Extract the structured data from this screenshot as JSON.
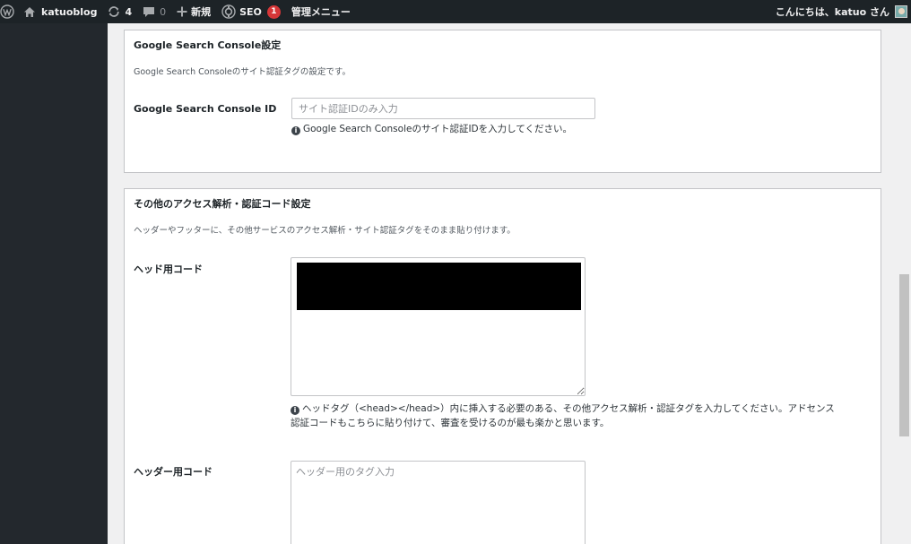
{
  "adminbar": {
    "site_name": "katuoblog",
    "updates_count": "4",
    "comments_count": "0",
    "new_label": "新規",
    "seo_label": "SEO",
    "seo_badge": "1",
    "admin_menu_label": "管理メニュー",
    "greeting": "こんにちは、katuo さん"
  },
  "gsc_panel": {
    "title": "Google Search Console設定",
    "description": "Google Search Consoleのサイト認証タグの設定です。",
    "field_label": "Google Search Console ID",
    "field_placeholder": "サイト認証IDのみ入力",
    "field_value": "",
    "help_text": "Google Search Consoleのサイト認証IDを入力してください。"
  },
  "other_panel": {
    "title": "その他のアクセス解析・認証コード設定",
    "description": "ヘッダーやフッターに、その他サービスのアクセス解析・サイト認証タグをそのまま貼り付けます。",
    "head_label": "ヘッド用コード",
    "head_help_line1": "ヘッドタグ（<head></head>）内に挿入する必要のある、その他アクセス解析・認証タグを入力してください。アドセンス",
    "head_help_line2": "認証コードもこちらに貼り付けて、審査を受けるのが最も楽かと思います。",
    "header_label": "ヘッダー用コード",
    "header_placeholder": "ヘッダー用のタグ入力"
  },
  "colors": {
    "adminbar_bg": "#1d2327",
    "sidebar_bg": "#23282d",
    "content_bg": "#f0f0f1",
    "badge_red": "#d63638"
  },
  "icons": [
    "wordpress-logo-icon",
    "home-icon",
    "updates-icon",
    "comment-icon",
    "plus-icon",
    "seo-gear-icon",
    "info-icon",
    "avatar"
  ]
}
